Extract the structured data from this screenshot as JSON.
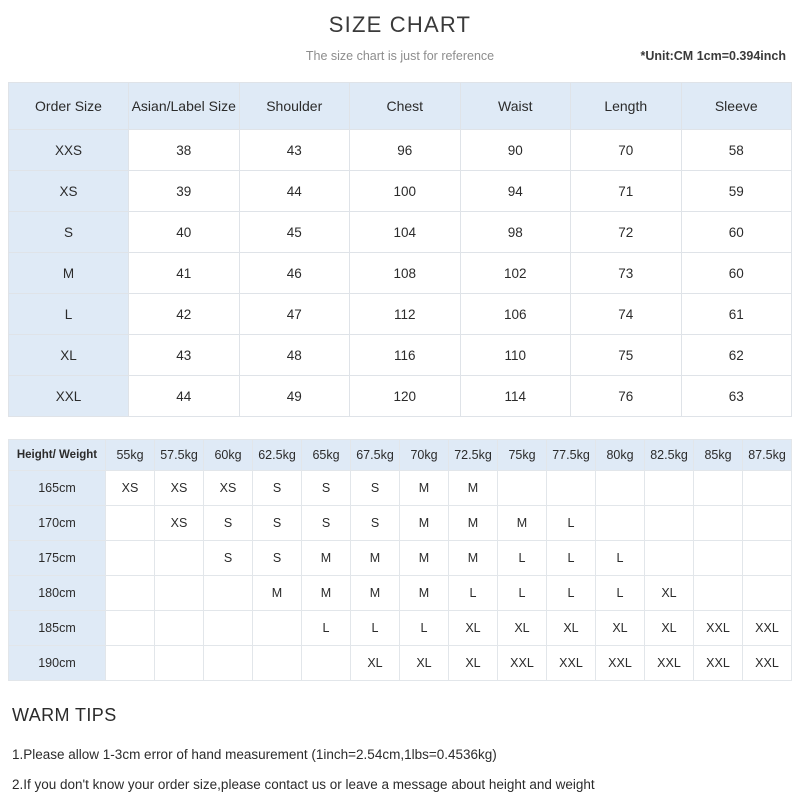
{
  "header": {
    "title": "SIZE CHART",
    "subtitle": "The size chart is just for reference",
    "unit_note": "*Unit:CM 1cm=0.394inch"
  },
  "size_table": {
    "columns": [
      "Order Size",
      "Asian/Label Size",
      "Shoulder",
      "Chest",
      "Waist",
      "Length",
      "Sleeve"
    ],
    "rows": [
      {
        "order_size": "XXS",
        "values": [
          "38",
          "43",
          "96",
          "90",
          "70",
          "58"
        ]
      },
      {
        "order_size": "XS",
        "values": [
          "39",
          "44",
          "100",
          "94",
          "71",
          "59"
        ]
      },
      {
        "order_size": "S",
        "values": [
          "40",
          "45",
          "104",
          "98",
          "72",
          "60"
        ]
      },
      {
        "order_size": "M",
        "values": [
          "41",
          "46",
          "108",
          "102",
          "73",
          "60"
        ]
      },
      {
        "order_size": "L",
        "values": [
          "42",
          "47",
          "112",
          "106",
          "74",
          "61"
        ]
      },
      {
        "order_size": "XL",
        "values": [
          "43",
          "48",
          "116",
          "110",
          "75",
          "62"
        ]
      },
      {
        "order_size": "XXL",
        "values": [
          "44",
          "49",
          "120",
          "114",
          "76",
          "63"
        ]
      }
    ]
  },
  "grid_table": {
    "corner_label": "Height/ Weight",
    "weights": [
      "55kg",
      "57.5kg",
      "60kg",
      "62.5kg",
      "65kg",
      "67.5kg",
      "70kg",
      "72.5kg",
      "75kg",
      "77.5kg",
      "80kg",
      "82.5kg",
      "85kg",
      "87.5kg"
    ],
    "rows": [
      {
        "height": "165cm",
        "cells": [
          {
            "label": "XS",
            "color": "yellow"
          },
          {
            "label": "XS",
            "color": "yellow"
          },
          {
            "label": "XS",
            "color": "yellow"
          },
          {
            "label": "S",
            "color": "pink"
          },
          {
            "label": "S",
            "color": "pink"
          },
          {
            "label": "S",
            "color": "pink"
          },
          {
            "label": "M",
            "color": "yellow"
          },
          {
            "label": "M",
            "color": "yellow"
          },
          {
            "label": "",
            "color": "none"
          },
          {
            "label": "",
            "color": "none"
          },
          {
            "label": "",
            "color": "none"
          },
          {
            "label": "",
            "color": "none"
          },
          {
            "label": "",
            "color": "none"
          },
          {
            "label": "",
            "color": "none"
          }
        ]
      },
      {
        "height": "170cm",
        "cells": [
          {
            "label": "",
            "color": "none"
          },
          {
            "label": "XS",
            "color": "yellow"
          },
          {
            "label": "S",
            "color": "pink"
          },
          {
            "label": "S",
            "color": "pink"
          },
          {
            "label": "S",
            "color": "pink"
          },
          {
            "label": "S",
            "color": "pink"
          },
          {
            "label": "M",
            "color": "yellow"
          },
          {
            "label": "M",
            "color": "yellow"
          },
          {
            "label": "M",
            "color": "yellow"
          },
          {
            "label": "L",
            "color": "blue"
          },
          {
            "label": "",
            "color": "none"
          },
          {
            "label": "",
            "color": "none"
          },
          {
            "label": "",
            "color": "none"
          },
          {
            "label": "",
            "color": "none"
          }
        ]
      },
      {
        "height": "175cm",
        "cells": [
          {
            "label": "",
            "color": "none"
          },
          {
            "label": "",
            "color": "none"
          },
          {
            "label": "S",
            "color": "pink"
          },
          {
            "label": "S",
            "color": "pink"
          },
          {
            "label": "M",
            "color": "yellow"
          },
          {
            "label": "M",
            "color": "yellow"
          },
          {
            "label": "M",
            "color": "yellow"
          },
          {
            "label": "M",
            "color": "yellow"
          },
          {
            "label": "L",
            "color": "blue"
          },
          {
            "label": "L",
            "color": "blue"
          },
          {
            "label": "L",
            "color": "blue"
          },
          {
            "label": "",
            "color": "none"
          },
          {
            "label": "",
            "color": "none"
          },
          {
            "label": "",
            "color": "none"
          }
        ]
      },
      {
        "height": "180cm",
        "cells": [
          {
            "label": "",
            "color": "none"
          },
          {
            "label": "",
            "color": "none"
          },
          {
            "label": "",
            "color": "none"
          },
          {
            "label": "M",
            "color": "yellow"
          },
          {
            "label": "M",
            "color": "yellow"
          },
          {
            "label": "M",
            "color": "yellow"
          },
          {
            "label": "M",
            "color": "yellow"
          },
          {
            "label": "L",
            "color": "blue"
          },
          {
            "label": "L",
            "color": "blue"
          },
          {
            "label": "L",
            "color": "blue"
          },
          {
            "label": "L",
            "color": "blue"
          },
          {
            "label": "XL",
            "color": "green"
          },
          {
            "label": "",
            "color": "none"
          },
          {
            "label": "",
            "color": "none"
          }
        ]
      },
      {
        "height": "185cm",
        "cells": [
          {
            "label": "",
            "color": "none"
          },
          {
            "label": "",
            "color": "none"
          },
          {
            "label": "",
            "color": "none"
          },
          {
            "label": "",
            "color": "none"
          },
          {
            "label": "L",
            "color": "blue"
          },
          {
            "label": "L",
            "color": "blue"
          },
          {
            "label": "L",
            "color": "blue"
          },
          {
            "label": "XL",
            "color": "green"
          },
          {
            "label": "XL",
            "color": "green"
          },
          {
            "label": "XL",
            "color": "green"
          },
          {
            "label": "XL",
            "color": "green"
          },
          {
            "label": "XL",
            "color": "green"
          },
          {
            "label": "XXL",
            "color": "yellow"
          },
          {
            "label": "XXL",
            "color": "yellow"
          }
        ]
      },
      {
        "height": "190cm",
        "cells": [
          {
            "label": "",
            "color": "none"
          },
          {
            "label": "",
            "color": "none"
          },
          {
            "label": "",
            "color": "none"
          },
          {
            "label": "",
            "color": "none"
          },
          {
            "label": "",
            "color": "none"
          },
          {
            "label": "XL",
            "color": "green"
          },
          {
            "label": "XL",
            "color": "green"
          },
          {
            "label": "XL",
            "color": "green"
          },
          {
            "label": "XXL",
            "color": "yellow"
          },
          {
            "label": "XXL",
            "color": "yellow"
          },
          {
            "label": "XXL",
            "color": "yellow"
          },
          {
            "label": "XXL",
            "color": "yellow"
          },
          {
            "label": "XXL",
            "color": "yellow"
          },
          {
            "label": "XXL",
            "color": "yellow"
          }
        ]
      }
    ]
  },
  "tips": {
    "title": "WARM TIPS",
    "lines": [
      "1.Please allow 1-3cm error of hand measurement (1inch=2.54cm,1lbs=0.4536kg)",
      "2.If you don't know your order size,please contact us or leave a message about height and weight"
    ]
  },
  "colors": {
    "header_blue": "#dfeaf6",
    "cell_yellow": "#fdf0cd",
    "cell_pink": "#fbe1d4",
    "cell_blue": "#dce8f5",
    "cell_green": "#dfeacf",
    "border": "#dfe3e8"
  }
}
